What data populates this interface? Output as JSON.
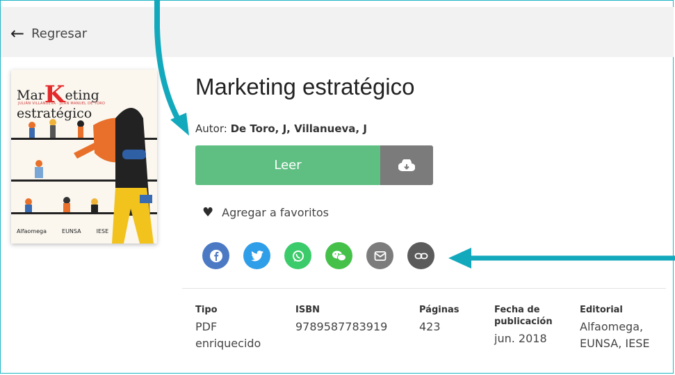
{
  "header": {
    "back_label": "Regresar"
  },
  "cover": {
    "title_prefix": "Mar",
    "title_letter": "K",
    "title_suffix": "eting estratégico",
    "authors_line": "JULIÁN VILLANUEVA · JUAN MANUEL DE TORO",
    "footer": [
      "Alfaomega",
      "EUNSA",
      "IESE"
    ]
  },
  "book": {
    "title": "Marketing estratégico",
    "author_label": "Autor:",
    "author_names": "De Toro, J, Villanueva, J"
  },
  "actions": {
    "read_label": "Leer",
    "download_icon": "cloud-download-icon",
    "favorite_label": "Agregar a favoritos"
  },
  "share": [
    {
      "name": "facebook-icon",
      "color": "#4c79c4"
    },
    {
      "name": "twitter-icon",
      "color": "#2f9ee8"
    },
    {
      "name": "whatsapp-icon",
      "color": "#3ccb6a"
    },
    {
      "name": "wechat-icon",
      "color": "#45c14a"
    },
    {
      "name": "email-icon",
      "color": "#7c7c7c"
    },
    {
      "name": "link-icon",
      "color": "#5b5b5b"
    }
  ],
  "details": [
    {
      "label": "Tipo",
      "value": "PDF enriquecido"
    },
    {
      "label": "ISBN",
      "value": "9789587783919"
    },
    {
      "label": "Páginas",
      "value": "423"
    },
    {
      "label": "Fecha de publicación",
      "value": "jun. 2018"
    },
    {
      "label": "Editorial",
      "value": "Alfaomega, EUNSA, IESE"
    }
  ],
  "colors": {
    "accent": "#13a9bd",
    "read_button": "#5fbf82",
    "download_button": "#7b7b7b"
  }
}
